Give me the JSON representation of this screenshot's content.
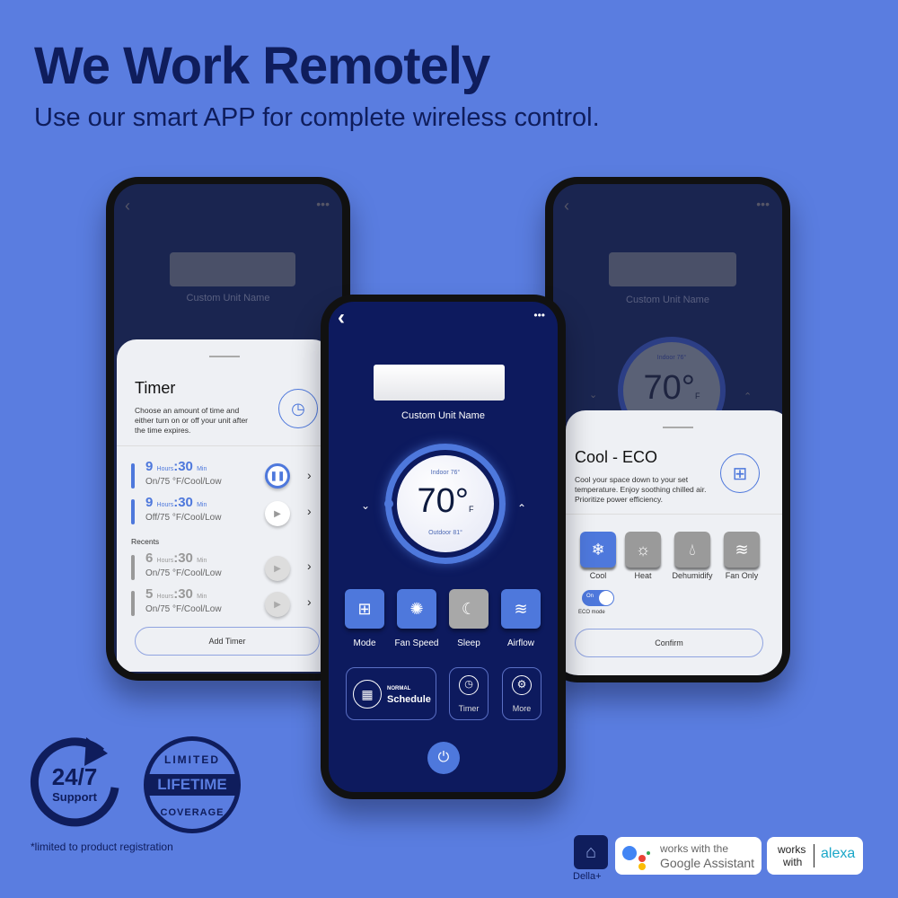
{
  "header": {
    "title": "We Work Remotely",
    "subtitle": "Use our smart APP for complete wireless control."
  },
  "colors": {
    "background": "#5a7de0",
    "navy": "#0f1d5c",
    "accent": "#4e78dc",
    "screen": "#0d1a5e"
  },
  "left_phone": {
    "unit_name": "Custom Unit Name",
    "sheet": {
      "title": "Timer",
      "description": "Choose an amount of time and either turn on or off your unit after the time expires.",
      "active": [
        {
          "hours": "9",
          "minutes": "30",
          "detail": "On/75 °F/Cool/Low",
          "state": "paused"
        },
        {
          "hours": "9",
          "minutes": "30",
          "detail": "Off/75 °F/Cool/Low",
          "state": "play"
        }
      ],
      "recents_label": "Recents",
      "recents": [
        {
          "hours": "6",
          "minutes": "30",
          "detail": "On/75 °F/Cool/Low"
        },
        {
          "hours": "5",
          "minutes": "30",
          "detail": "On/75 °F/Cool/Low"
        }
      ],
      "hours_label": "Hours",
      "min_label": "Min",
      "add_button": "Add Timer"
    }
  },
  "center_phone": {
    "unit_name": "Custom Unit Name",
    "indoor": "Indoor 76°",
    "temperature": "70°",
    "unit": "F",
    "outdoor": "Outdoor 81°",
    "controls": [
      {
        "label": "Mode",
        "icon": "grid-icon",
        "active": true
      },
      {
        "label": "Fan Speed",
        "icon": "fan-icon",
        "active": true
      },
      {
        "label": "Sleep",
        "icon": "moon-icon",
        "active": false
      },
      {
        "label": "Airflow",
        "icon": "wind-icon",
        "active": true
      }
    ],
    "schedule": {
      "mode": "NORMAL",
      "label": "Schedule"
    },
    "timer_label": "Timer",
    "more_label": "More"
  },
  "right_phone": {
    "unit_name": "Custom Unit Name",
    "indoor": "Indoor 76°",
    "temperature": "70°",
    "unit": "F",
    "sheet": {
      "title": "Cool - ECO",
      "description": "Cool your space down to your set temperature. Enjoy soothing chilled air. Prioritize power efficiency.",
      "modes": [
        {
          "label": "Cool",
          "icon": "snowflake-icon",
          "active": true
        },
        {
          "label": "Heat",
          "icon": "sun-icon",
          "active": false
        },
        {
          "label": "Dehumidify",
          "icon": "droplet-icon",
          "active": false
        },
        {
          "label": "Fan Only",
          "icon": "wind-icon",
          "active": false
        }
      ],
      "eco_toggle": {
        "state": "On",
        "label": "ECO mode",
        "on": true
      },
      "confirm": "Confirm"
    }
  },
  "footer": {
    "support_number": "24/7",
    "support_label": "Support",
    "seal_top": "LIMITED",
    "seal_main": "LIFETIME",
    "seal_bottom": "COVERAGE",
    "note": "*limited to product registration",
    "della_label": "Della+",
    "google_line1": "works with the",
    "google_line2": "Google Assistant",
    "alexa_works": "works",
    "alexa_with": "with",
    "alexa": "alexa"
  }
}
